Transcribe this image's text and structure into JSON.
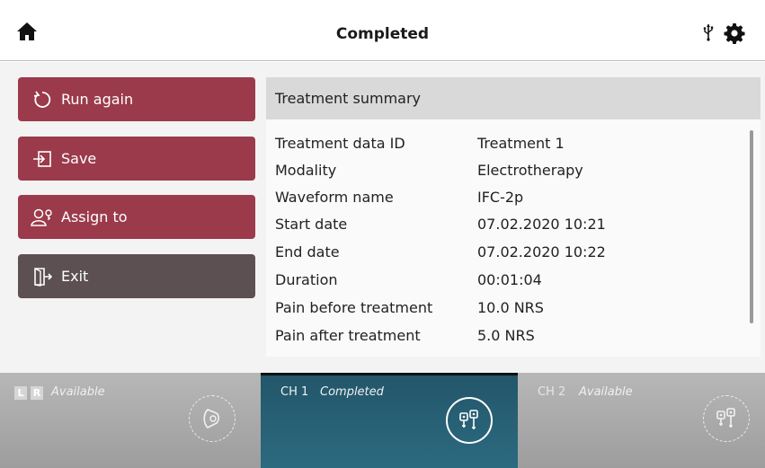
{
  "header": {
    "title": "Completed",
    "home_icon": "home-icon",
    "usb_icon": "usb-icon",
    "settings_icon": "gear-icon"
  },
  "actions": {
    "run_again": "Run again",
    "save": "Save",
    "assign_to": "Assign to",
    "exit": "Exit"
  },
  "summary": {
    "title": "Treatment summary",
    "rows": [
      {
        "label": "Treatment data ID",
        "value": "Treatment 1"
      },
      {
        "label": "Modality",
        "value": "Electrotherapy"
      },
      {
        "label": "Waveform name",
        "value": "IFC-2p"
      },
      {
        "label": "Start date",
        "value": "07.02.2020 10:21"
      },
      {
        "label": "End date",
        "value": "07.02.2020 10:22"
      },
      {
        "label": "Duration",
        "value": "00:01:04"
      },
      {
        "label": "Pain before treatment",
        "value": "10.0 NRS"
      },
      {
        "label": "Pain after treatment",
        "value": "5.0 NRS"
      }
    ]
  },
  "channels": {
    "left": {
      "l": "L",
      "r": "R",
      "status": "Available"
    },
    "ch1": {
      "name": "CH 1",
      "status": "Completed"
    },
    "ch2": {
      "name": "CH 2",
      "status": "Available"
    }
  },
  "colors": {
    "button_red": "#9b3a4b",
    "button_dark": "#5c5053",
    "channel_active": "#2a6277",
    "channel_idle": "#a9a9a9"
  }
}
